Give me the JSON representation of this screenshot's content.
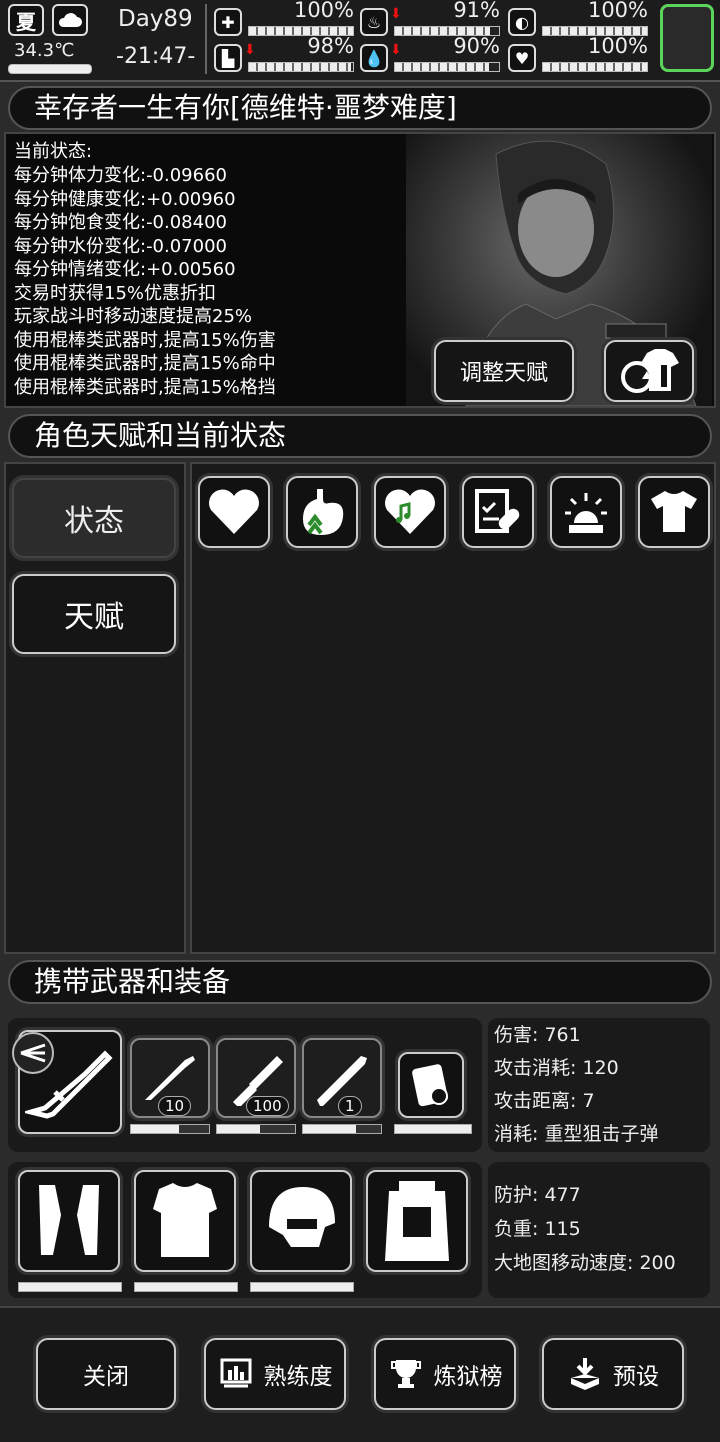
{
  "topbar": {
    "season": "夏",
    "weather_icon": "cloud-icon",
    "temperature": "34.3℃",
    "day": "Day89",
    "time": "-21:47-",
    "stats": [
      {
        "name": "health-kit",
        "icon": "medkit-icon",
        "value": "100%",
        "fill": 1.0,
        "arrow": false
      },
      {
        "name": "stomach",
        "icon": "stomach-icon",
        "value": "91%",
        "fill": 0.91,
        "arrow": true
      },
      {
        "name": "pill",
        "icon": "pill-icon",
        "value": "100%",
        "fill": 1.0,
        "arrow": false
      },
      {
        "name": "stamina",
        "icon": "boot-icon",
        "value": "98%",
        "fill": 0.98,
        "arrow": true
      },
      {
        "name": "water",
        "icon": "water-drop-icon",
        "value": "90%",
        "fill": 0.9,
        "arrow": true
      },
      {
        "name": "mood",
        "icon": "heart-icon",
        "value": "100%",
        "fill": 1.0,
        "arrow": false
      }
    ],
    "accent_color": "#5bd45b"
  },
  "character": {
    "title": "幸存者一生有你[德维特·噩梦难度]",
    "status_heading": "当前状态:",
    "status_lines": [
      "每分钟体力变化:-0.09660",
      "每分钟健康变化:+0.00960",
      "每分钟饱食变化:-0.08400",
      "每分钟水份变化:-0.07000",
      "每分钟情绪变化:+0.00560",
      "交易时获得15%优惠折扣",
      "玩家战斗时移动速度提高25%",
      "使用棍棒类武器时,提高15%伤害",
      "使用棍棒类武器时,提高15%命中",
      "使用棍棒类武器时,提高15%格挡"
    ],
    "adjust_talent_label": "调整天赋"
  },
  "talents": {
    "section_title": "角色天赋和当前状态",
    "tabs": [
      "状态",
      "天赋"
    ],
    "icons": [
      "heart-icon",
      "stomach-icon",
      "music-heart-icon",
      "clipboard-pill-icon",
      "alarm-light-icon",
      "shirt-icon"
    ]
  },
  "equipment": {
    "section_title": "携带武器和装备",
    "weapons": [
      {
        "icon": "sniper-rifle-icon",
        "count": null,
        "durability": 1.0
      },
      {
        "icon": "assault-rifle-icon",
        "count": "10",
        "durability": 0.62
      },
      {
        "icon": "minigun-icon",
        "count": "100",
        "durability": 0.55
      },
      {
        "icon": "rocket-launcher-icon",
        "count": "1",
        "durability": 0.68
      },
      {
        "icon": "medkit-case-icon",
        "count": null,
        "durability": 1.0
      }
    ],
    "weapon_stats": [
      "伤害: 761",
      "攻击消耗: 120",
      "攻击距离: 7",
      "消耗: 重型狙击子弹"
    ],
    "armor": [
      {
        "icon": "gloves-icon",
        "durability": 1.0
      },
      {
        "icon": "body-armor-icon",
        "durability": 1.0
      },
      {
        "icon": "helmet-icon",
        "durability": 1.0
      },
      {
        "icon": "backpack-icon",
        "durability": null
      }
    ],
    "armor_stats": [
      "防护: 477",
      "负重: 115",
      "大地图移动速度: 200"
    ]
  },
  "bottom_nav": {
    "close": "关闭",
    "proficiency": "熟练度",
    "ranking": "炼狱榜",
    "preset": "预设"
  }
}
